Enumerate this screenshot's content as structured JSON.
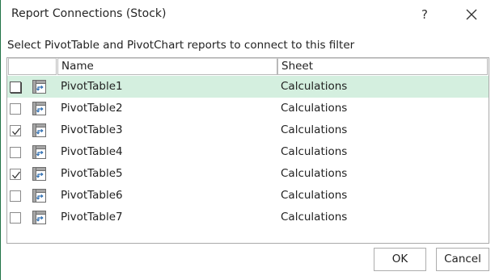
{
  "window": {
    "title": "Report Connections (Stock)",
    "help_label": "?",
    "close_icon": "close-icon"
  },
  "instruction": "Select PivotTable and PivotChart reports to connect to this filter",
  "list": {
    "columns": [
      "",
      "Name",
      "Sheet"
    ],
    "rows": [
      {
        "name": "PivotTable1",
        "sheet": "Calculations",
        "checked": false,
        "selected": true
      },
      {
        "name": "PivotTable2",
        "sheet": "Calculations",
        "checked": false,
        "selected": false
      },
      {
        "name": "PivotTable3",
        "sheet": "Calculations",
        "checked": true,
        "selected": false
      },
      {
        "name": "PivotTable4",
        "sheet": "Calculations",
        "checked": false,
        "selected": false
      },
      {
        "name": "PivotTable5",
        "sheet": "Calculations",
        "checked": true,
        "selected": false
      },
      {
        "name": "PivotTable6",
        "sheet": "Calculations",
        "checked": false,
        "selected": false
      },
      {
        "name": "PivotTable7",
        "sheet": "Calculations",
        "checked": false,
        "selected": false
      }
    ],
    "row_icon": "pivottable-icon"
  },
  "buttons": {
    "ok_label": "OK",
    "cancel_label": "Cancel"
  },
  "colors": {
    "selected_row": "#d4efdf",
    "window_accent": "#217346"
  }
}
